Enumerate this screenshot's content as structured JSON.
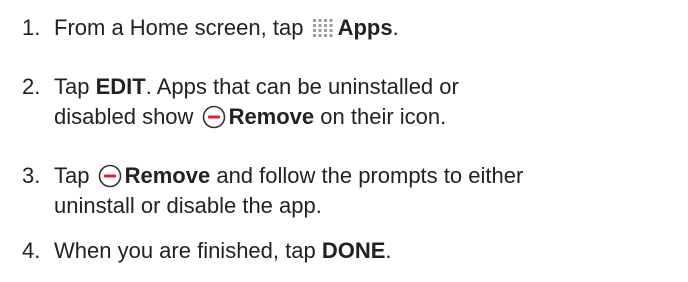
{
  "steps": [
    {
      "number": "1.",
      "text_before": "From a Home screen, tap",
      "icon": "apps-grid-icon",
      "bold": "Apps",
      "text_after": "."
    },
    {
      "number": "2.",
      "text_tap": "Tap",
      "bold_edit": "EDIT",
      "text_rest": ". Apps that can be uninstalled or",
      "line2_before": "disabled show",
      "icon": "remove-icon",
      "bold_remove": "Remove",
      "line2_after": "on their icon."
    },
    {
      "number": "3.",
      "text_tap": "Tap",
      "icon": "remove-icon",
      "bold_remove": "Remove",
      "text_after": "and follow the prompts to either",
      "line2": "uninstall or disable the app."
    },
    {
      "number": "4.",
      "text_before": "When you are finished, tap",
      "bold": "DONE",
      "text_after": "."
    }
  ],
  "colors": {
    "text": "#222222",
    "remove_icon": "#d6232f",
    "apps_icon_dots": "#9e9e9e"
  }
}
